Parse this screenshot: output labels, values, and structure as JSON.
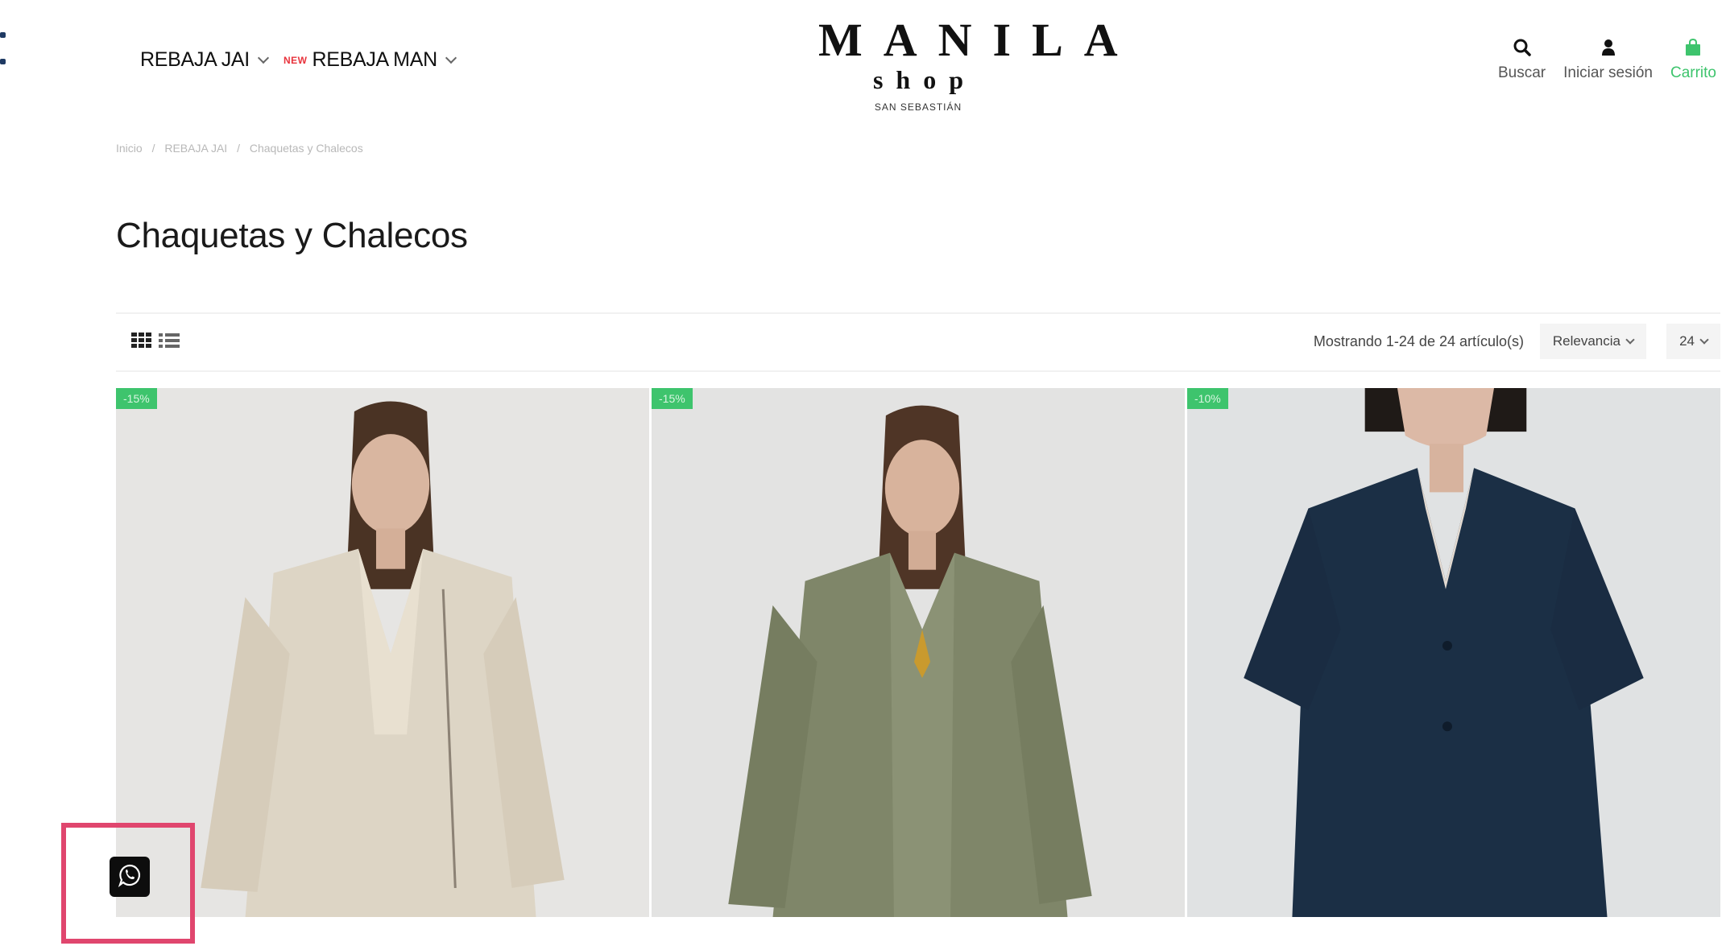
{
  "header": {
    "nav": [
      {
        "label": "REBAJA JAI",
        "badge": ""
      },
      {
        "label": "REBAJA MAN",
        "badge": "NEW"
      }
    ],
    "logo": {
      "line1": "MANILA",
      "line2": "shop",
      "line3": "SAN SEBASTIÁN"
    },
    "actions": [
      {
        "label": "Buscar",
        "icon": "search-icon"
      },
      {
        "label": "Iniciar sesión",
        "icon": "user-icon"
      },
      {
        "label": "Carrito",
        "icon": "shopping-bag-icon"
      }
    ]
  },
  "breadcrumb": [
    "Inicio",
    "/",
    "REBAJA JAI",
    "/",
    "Chaquetas y Chalecos"
  ],
  "page_title": "Chaquetas y Chalecos",
  "toolbar": {
    "count_text": "Mostrando 1-24 de 24 artículo(s)",
    "sort_label": "Relevancia",
    "per_page": "24",
    "view_icons": [
      "grid-view-icon",
      "list-view-icon"
    ]
  },
  "products": [
    {
      "discount": "-15%",
      "garment": "beige linen jacket"
    },
    {
      "discount": "-15%",
      "garment": "olive linen coat"
    },
    {
      "discount": "-10%",
      "garment": "navy short-sleeve jacket"
    }
  ],
  "colors": {
    "accent_green": "#3ec46d",
    "new_badge_red": "#e8333c",
    "highlight_pink": "#e0466e",
    "whatsapp_button": "#0d0d0d"
  },
  "floating": {
    "icon": "whatsapp-icon"
  }
}
